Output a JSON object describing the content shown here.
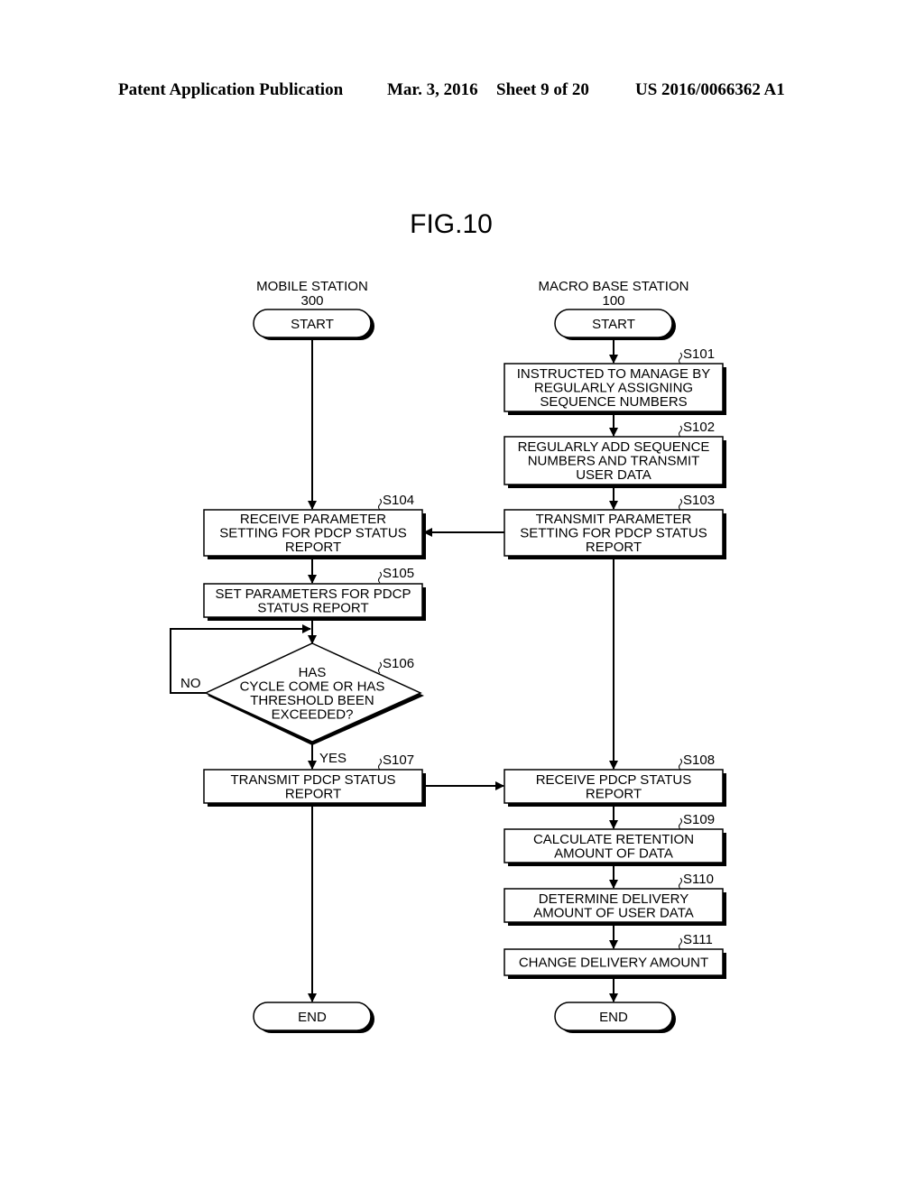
{
  "header": {
    "publication": "Patent Application Publication",
    "date": "Mar. 3, 2016",
    "sheet": "Sheet 9 of 20",
    "number": "US 2016/0066362 A1"
  },
  "figure": {
    "title": "FIG.10",
    "lanes": [
      {
        "name": "MOBILE STATION",
        "ref": "300"
      },
      {
        "name": "MACRO BASE STATION",
        "ref": "100"
      }
    ],
    "terminals": {
      "start": "START",
      "end": "END"
    },
    "steps": {
      "S101": {
        "id": "S101",
        "lines": [
          "INSTRUCTED TO MANAGE BY",
          "REGULARLY ASSIGNING",
          "SEQUENCE NUMBERS"
        ]
      },
      "S102": {
        "id": "S102",
        "lines": [
          "REGULARLY ADD SEQUENCE",
          "NUMBERS AND TRANSMIT",
          "USER DATA"
        ]
      },
      "S103": {
        "id": "S103",
        "lines": [
          "TRANSMIT PARAMETER",
          "SETTING FOR PDCP STATUS",
          "REPORT"
        ]
      },
      "S104": {
        "id": "S104",
        "lines": [
          "RECEIVE PARAMETER",
          "SETTING FOR PDCP STATUS",
          "REPORT"
        ]
      },
      "S105": {
        "id": "S105",
        "lines": [
          "SET PARAMETERS FOR PDCP",
          "STATUS REPORT"
        ]
      },
      "S106": {
        "id": "S106",
        "lines": [
          "HAS",
          "CYCLE COME OR HAS",
          "THRESHOLD BEEN",
          "EXCEEDED?"
        ]
      },
      "S107": {
        "id": "S107",
        "lines": [
          "TRANSMIT PDCP STATUS",
          "REPORT"
        ]
      },
      "S108": {
        "id": "S108",
        "lines": [
          "RECEIVE PDCP STATUS",
          "REPORT"
        ]
      },
      "S109": {
        "id": "S109",
        "lines": [
          "CALCULATE RETENTION",
          "AMOUNT OF DATA"
        ]
      },
      "S110": {
        "id": "S110",
        "lines": [
          "DETERMINE DELIVERY",
          "AMOUNT OF USER DATA"
        ]
      },
      "S111": {
        "id": "S111",
        "lines": [
          "CHANGE DELIVERY AMOUNT"
        ]
      }
    },
    "branch_labels": {
      "no": "NO",
      "yes": "YES"
    }
  }
}
